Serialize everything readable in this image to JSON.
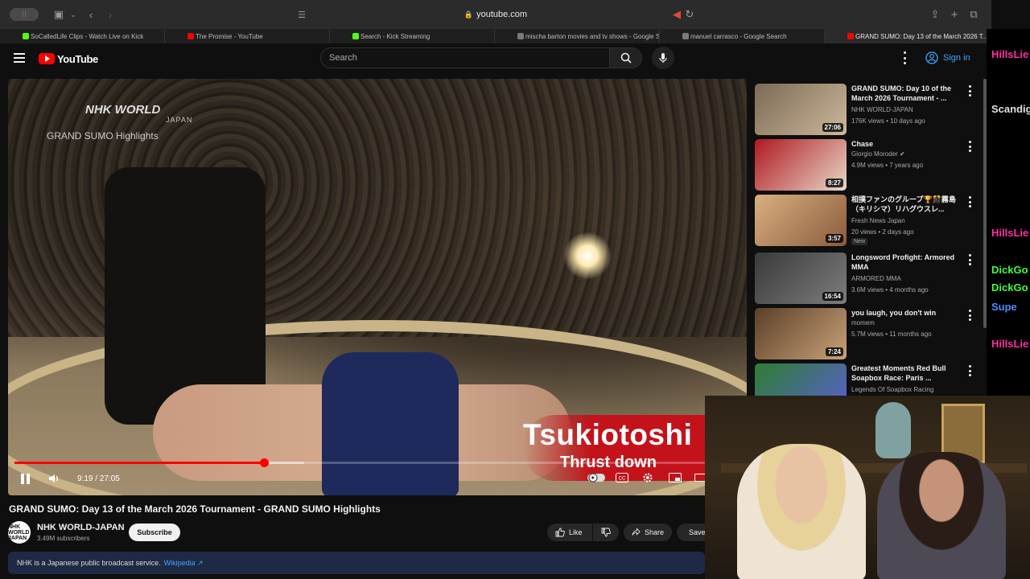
{
  "browser": {
    "url": "youtube.com",
    "tabs": [
      {
        "label": "SoCalledLife Clips - Watch Live on Kick",
        "color": "#53fc18"
      },
      {
        "label": "The Promise - YouTube",
        "color": "#ff0000"
      },
      {
        "label": "Search - Kick Streaming",
        "color": "#53fc18"
      },
      {
        "label": "mischa barton movies and tv shows - Google S...",
        "color": "#7a7a7a"
      },
      {
        "label": "manuel carrasco - Google Search",
        "color": "#7a7a7a"
      },
      {
        "label": "GRAND SUMO: Day 13 of the March 2026 T...",
        "color": "#ff0000"
      }
    ]
  },
  "header": {
    "logo": "YouTube",
    "search_placeholder": "Search",
    "signin": "Sign in"
  },
  "video": {
    "overlay_brand": "NHK WORLD",
    "overlay_brand_sub": "JAPAN",
    "overlay_highlights": "GRAND SUMO Highlights",
    "kimarite": "Tsukiotoshi",
    "kimarite_en": "Thrust down",
    "time": "9:19 / 27:05",
    "progress": 0.344,
    "buffered": 0.4
  },
  "meta": {
    "title": "GRAND SUMO: Day 13 of the March 2026 Tournament - GRAND SUMO Highlights",
    "channel": "NHK WORLD-JAPAN",
    "avatar": "NHK WORLD JAPAN",
    "subscribers": "3.49M subscribers",
    "subscribe": "Subscribe",
    "like": "Like",
    "share": "Share",
    "save": "Save",
    "info_text": "NHK is a Japanese public broadcast service.",
    "info_link": "Wikipedia ↗"
  },
  "recommendations": [
    {
      "title": "GRAND SUMO: Day 10 of the March 2026 Tournament - ...",
      "channel": "NHK WORLD-JAPAN",
      "meta": "176K views • 10 days ago",
      "duration": "27:06",
      "badge": "",
      "colors": [
        "#7b6a55",
        "#cdb89a"
      ]
    },
    {
      "title": "Chase",
      "channel": "Giorgio Moroder ✔",
      "meta": "4.9M views • 7 years ago",
      "duration": "8:27",
      "badge": "",
      "colors": [
        "#b01820",
        "#e7d9c8"
      ]
    },
    {
      "title": "相撲ファンのグループ🏆🎊霧島（キリシマ）リハグウスレ...",
      "channel": "Fresh News Japan",
      "meta": "20 views • 2 days ago",
      "duration": "3:57",
      "badge": "New",
      "colors": [
        "#d9b07f",
        "#8a5c3d"
      ]
    },
    {
      "title": "Longsword Profight: Armored MMA",
      "channel": "ARMORED MMA",
      "meta": "3.6M views • 4 months ago",
      "duration": "16:54",
      "badge": "",
      "colors": [
        "#3a3a3a",
        "#7d7d7d"
      ]
    },
    {
      "title": "you laugh, you don't win",
      "channel": "momem",
      "meta": "5.7M views • 11 months ago",
      "duration": "7:24",
      "badge": "",
      "colors": [
        "#5b3f27",
        "#c9a27a"
      ]
    },
    {
      "title": "Greatest Moments Red Bull Soapbox Race: Paris ...",
      "channel": "Legends Of Soapbox Racing",
      "meta": "",
      "duration": "",
      "badge": "",
      "colors": [
        "#2e7d32",
        "#5a5fd1"
      ]
    }
  ],
  "edge_chat": [
    {
      "text": "HillsLie",
      "color": "#ff2fa0"
    },
    {
      "text": "Scandig",
      "color": "#e0e0e0"
    },
    {
      "text": "HillsLie",
      "color": "#ff2fa0"
    },
    {
      "text": "DickGo",
      "color": "#3dff3d"
    },
    {
      "text": "DickGo",
      "color": "#3dff3d"
    },
    {
      "text": "Supe",
      "color": "#4a8cff"
    },
    {
      "text": "HillsLie",
      "color": "#ff2fa0"
    }
  ]
}
